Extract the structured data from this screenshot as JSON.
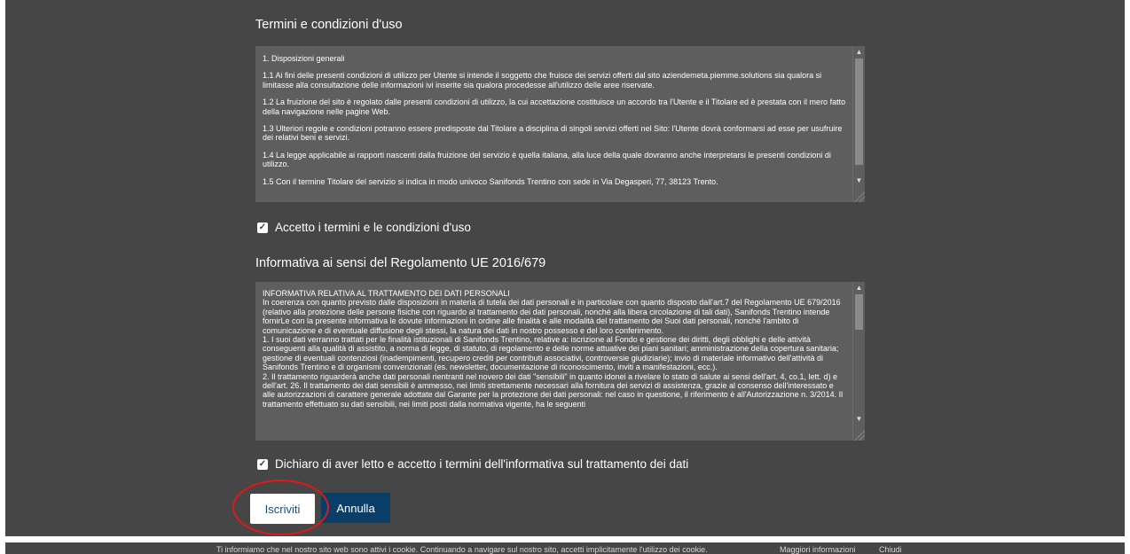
{
  "terms": {
    "title": "Termini e condizioni d'uso",
    "paragraphs": [
      "1.   Disposizioni generali",
      "1.1   Ai fini delle presenti condizioni di utilizzo per Utente si intende il soggetto che fruisce dei servizi offerti dal sito aziendemeta.piemme.solutions sia qualora si limitasse alla consultazione delle informazioni ivi inserite  sia qualora procedesse all'utilizzo delle aree riservate.",
      "1.2   La fruizione del sito è regolato dalle presenti condizioni di utilizzo, la cui accettazione costituisce un accordo tra l'Utente e il Titolare ed è prestata con il mero fatto della navigazione nelle pagine Web.",
      "1.3   Ulteriori regole e condizioni potranno essere predisposte dal Titolare a disciplina di singoli servizi offerti nel Sito: l'Utente dovrà conformarsi ad esse per usufruire dei relativi beni e servizi.",
      "1.4   La legge applicabile ai rapporti nascenti dalla fruizione del servizio è quella italiana, alla luce della quale dovranno anche interpretarsi le presenti condizioni di utilizzo.",
      "1.5   Con il termine Titolare del servizio si indica in modo univoco Sanifonds Trentino con sede in Via Degasperi, 77, 38123 Trento."
    ],
    "accept_label": "Accetto i termini e le condizioni d'uso"
  },
  "privacy": {
    "title": "Informativa ai sensi del Regolamento UE 2016/679",
    "text": "INFORMATIVA RELATIVA AL TRATTAMENTO DEI DATI PERSONALI\nIn coerenza con quanto previsto dalle disposizioni in materia di tutela dei dati personali e in particolare con quanto disposto dall'art.7 del Regolamento UE 679/2016 (relativo alla protezione delle persone fisiche con riguardo al trattamento dei dati personali, nonché alla libera circolazione di tali dati), Sanifonds Trentino intende fornirLe con la presente informativa le dovute informazioni in ordine alle finalità e alle modalità del trattamento dei Suoi dati personali, nonché l'ambito di comunicazione e di eventuale diffusione degli stessi, la natura dei dati in nostro possesso e del loro conferimento.\n1. I suoi dati verranno trattati per le finalità istituzionali di Sanifonds Trentino, relative a: iscrizione al Fondo e gestione dei diritti, degli obblighi e delle attività conseguenti alla qualità di assistito, a norma di legge, di statuto, di regolamento e delle norme attuative dei piani sanitari; amministrazione della copertura sanitaria; gestione di eventuali contenziosi (inadempimenti, recupero crediti per contributi associativi, controversie giudiziarie); invio di materiale informativo dell'attività di Sanifonds Trentino e di organismi convenzionati (es. newsletter, documentazione di riconoscimento, inviti a manifestazioni, ecc.).\n2. Il trattamento riguarderà anche dati personali rientranti nel novero dei dati \"sensibili\" in quanto idonei a rivelare lo stato di salute ai sensi dell'art. 4, co.1, lett. d) e dell'art. 26. Il trattamento dei dati sensibili è ammesso, nei limiti strettamente necessari alla fornitura dei servizi di assistenza, grazie al consenso dell'interessato e alle autorizzazioni di carattere generale adottate dal Garante per la protezione dei dati personali: nel caso in questione, il riferimento è all'Autorizzazione n. 3/2014. Il trattamento effettuato su dati sensibili, nei limiti posti dalla normativa vigente, ha le seguenti",
    "accept_label": "Dichiaro di aver letto e accetto i termini dell'informativa sul trattamento dei dati"
  },
  "buttons": {
    "subscribe": "Iscriviti",
    "cancel": "Annulla"
  },
  "cookie_bar": {
    "text": "Ti informiamo che nel nostro sito web sono attivi i cookie. Continuando a navigare sul nostro sito, accetti implicitamente l'utilizzo dei cookie.",
    "more_info": "Maggiori informazioni",
    "close": "Chiudi"
  },
  "colors": {
    "panel_bg": "#464646",
    "textbox_bg": "#5e5e5e",
    "primary_button": "#0a3e66",
    "highlight": "#e01818"
  }
}
